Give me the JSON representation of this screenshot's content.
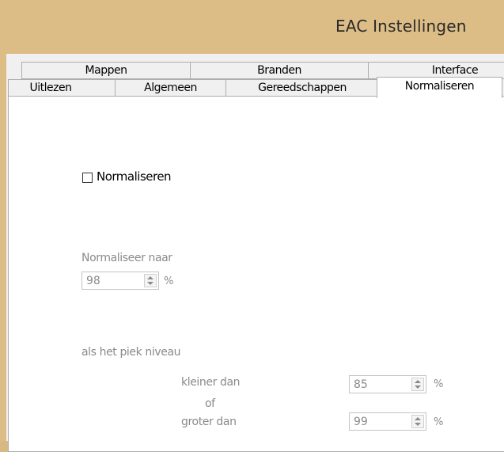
{
  "window": {
    "title": "EAC Instellingen"
  },
  "tabs_row1": [
    "Mappen",
    "Branden",
    "Interface"
  ],
  "tabs_row2": [
    "Uitlezen",
    "Algemeen",
    "Gereedschappen",
    "Normaliseren"
  ],
  "active_tab": "Normaliseren",
  "normalize": {
    "checkbox_label": "Normaliseren",
    "checked": false,
    "normalize_to_label": "Normaliseer naar",
    "normalize_to_value": "98",
    "percent": "%",
    "peak_label": "als het piek niveau",
    "smaller_label": "kleiner dan",
    "smaller_value": "85",
    "or_label": "of",
    "greater_label": "groter dan",
    "greater_value": "99"
  },
  "colors": {
    "titlebar": "#ddbd86",
    "disabled_text": "#8a8a8a"
  }
}
